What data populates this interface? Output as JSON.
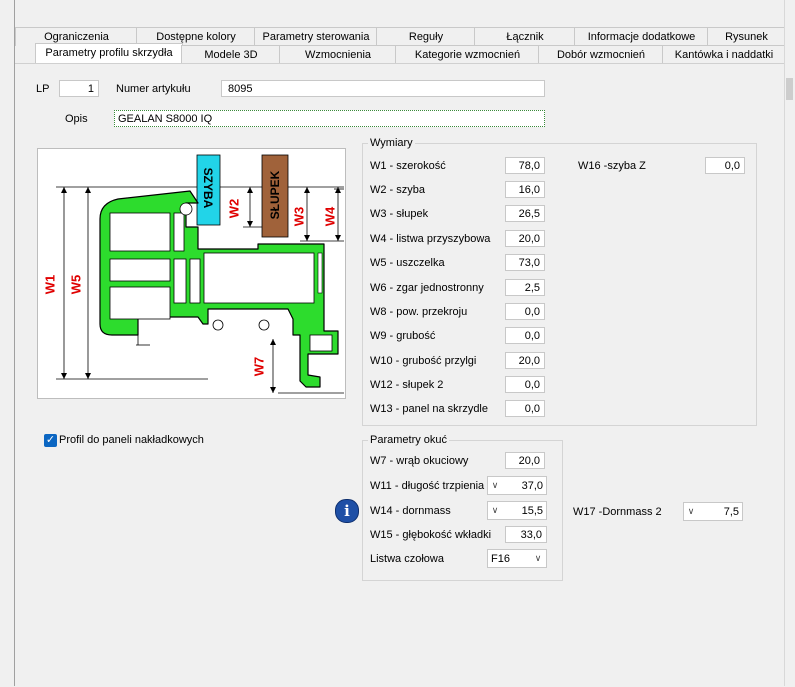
{
  "tabs_row1": [
    "Ograniczenia",
    "Dostępne kolory",
    "Parametry sterowania",
    "Reguły",
    "Łącznik",
    "Informacje dodatkowe",
    "Rysunek"
  ],
  "tabs_row2": [
    "Parametry profilu skrzydła",
    "Modele 3D",
    "Wzmocnienia",
    "Kategorie wzmocnień",
    "Dobór wzmocnień",
    "Kantówka i naddatki"
  ],
  "header": {
    "lp_label": "LP",
    "lp_value": "1",
    "article_label": "Numer artykułu",
    "article_value": "8095",
    "desc_label": "Opis",
    "desc_value": "GEALAN S8000 IQ"
  },
  "drawing": {
    "szyba": "SZYBA",
    "slupek": "SŁUPEK",
    "w1": "W1",
    "w2": "W2",
    "w3": "W3",
    "w4": "W4",
    "w5": "W5",
    "w7": "W7"
  },
  "checkbox": {
    "label": "Profil do paneli nakładkowych",
    "checked": true
  },
  "wymiary": {
    "title": "Wymiary",
    "rows": [
      {
        "label": "W1 - szerokość",
        "value": "78,0"
      },
      {
        "label": "W2 - szyba",
        "value": "16,0"
      },
      {
        "label": "W3 - słupek",
        "value": "26,5"
      },
      {
        "label": "W4 - listwa przyszybowa",
        "value": "20,0"
      },
      {
        "label": "W5 - uszczelka",
        "value": "73,0"
      },
      {
        "label": "W6 - zgar jednostronny",
        "value": "2,5"
      },
      {
        "label": "W8 - pow. przekroju",
        "value": "0,0"
      },
      {
        "label": "W9 - grubość",
        "value": "0,0"
      },
      {
        "label": "W10 - grubość przylgi",
        "value": "20,0"
      },
      {
        "label": "W12 - słupek 2",
        "value": "0,0"
      },
      {
        "label": "W13 - panel na skrzydle",
        "value": "0,0"
      }
    ],
    "w16_label": "W16 -szyba Z",
    "w16_value": "0,0"
  },
  "okuc": {
    "title": "Parametry okuć",
    "w7_label": "W7 - wrąb okuciowy",
    "w7_value": "20,0",
    "w11_label": "W11 - długość trzpienia",
    "w11_value": "37,0",
    "w14_label": "W14 - dornmass",
    "w14_value": "15,5",
    "w15_label": "W15 - głębokość wkładki",
    "w15_value": "33,0",
    "listwa_label": "Listwa czołowa",
    "listwa_value": "F16",
    "w17_label": "W17 -Dornmass 2",
    "w17_value": "7,5"
  },
  "icons": {
    "chevron": "∨",
    "check": "✓",
    "info": "i"
  }
}
